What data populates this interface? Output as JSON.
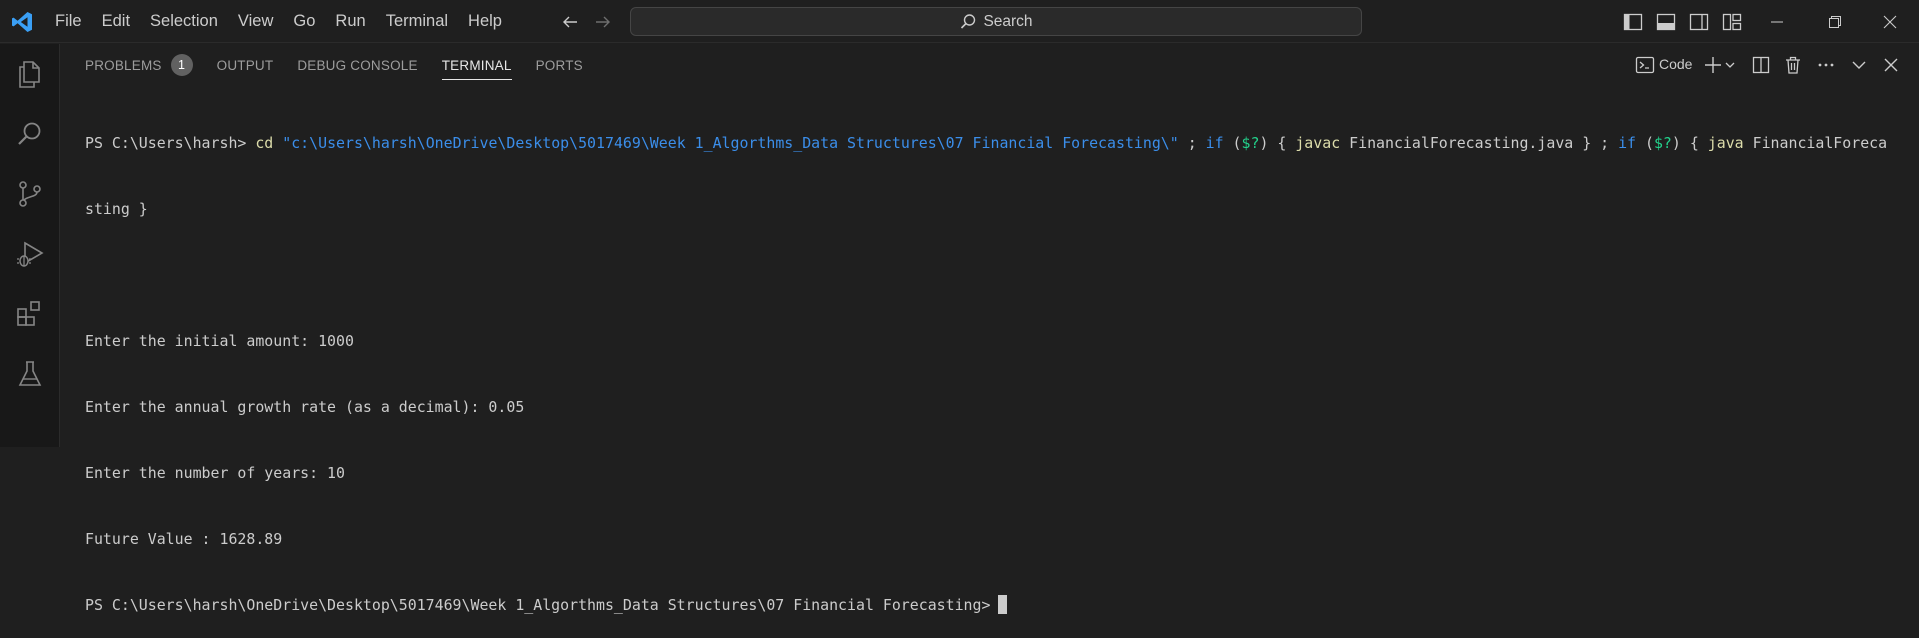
{
  "titlebar": {
    "menu": [
      "File",
      "Edit",
      "Selection",
      "View",
      "Go",
      "Run",
      "Terminal",
      "Help"
    ],
    "search_label": "Search"
  },
  "panel": {
    "tabs": [
      {
        "label": "PROBLEMS",
        "badge": "1"
      },
      {
        "label": "OUTPUT"
      },
      {
        "label": "DEBUG CONSOLE"
      },
      {
        "label": "TERMINAL",
        "active": true
      },
      {
        "label": "PORTS"
      }
    ],
    "terminal_profile": "Code"
  },
  "terminal": {
    "prompt1": "PS C:\\Users\\harsh> ",
    "cmd_cd": "cd",
    "cd_path": "\"c:\\Users\\harsh\\OneDrive\\Desktop\\5017469\\Week 1_Algorthms_Data Structures\\07 Financial Forecasting\\\"",
    "sep1": " ; ",
    "if1": "if",
    "cond_open1": " (",
    "cond1": "$?",
    "cond_close1": ") { ",
    "javac": "javac",
    "javac_arg": " FinancialForecasting.java } ; ",
    "if2": "if",
    "cond_open2": " (",
    "cond2": "$?",
    "cond_close2": ") { ",
    "java": "java",
    "java_arg_part1": " FinancialForeca",
    "java_arg_part2": "sting }",
    "output": [
      "Enter the initial amount: 1000",
      "Enter the annual growth rate (as a decimal): 0.05",
      "Enter the number of years: 10",
      "Future Value : 1628.89"
    ],
    "prompt2": "PS C:\\Users\\harsh\\OneDrive\\Desktop\\5017469\\Week 1_Algorthms_Data Structures\\07 Financial Forecasting>"
  },
  "colors": {
    "background": "#1f1f1f",
    "activitybar": "#181818",
    "accent_blue": "#3b8eea",
    "command_yellow": "#dcdcaa",
    "variable_green": "#23d18b",
    "vscode_logo": "#3a9ff5"
  },
  "icons": {
    "titlebar": [
      "vscode-logo",
      "arrow-left-icon",
      "arrow-right-icon",
      "search-icon",
      "toggle-primary-sidebar-icon",
      "toggle-panel-icon",
      "toggle-secondary-sidebar-icon",
      "customize-layout-icon",
      "minimize-icon",
      "restore-icon",
      "close-icon"
    ],
    "activitybar": [
      "explorer-icon",
      "search-icon",
      "source-control-icon",
      "run-debug-icon",
      "extensions-icon",
      "testing-icon"
    ],
    "panel_actions": [
      "terminal-icon",
      "new-terminal-plus-icon",
      "chevron-down-icon",
      "split-terminal-icon",
      "trash-icon",
      "more-icon",
      "chevron-down-icon",
      "close-icon"
    ]
  }
}
